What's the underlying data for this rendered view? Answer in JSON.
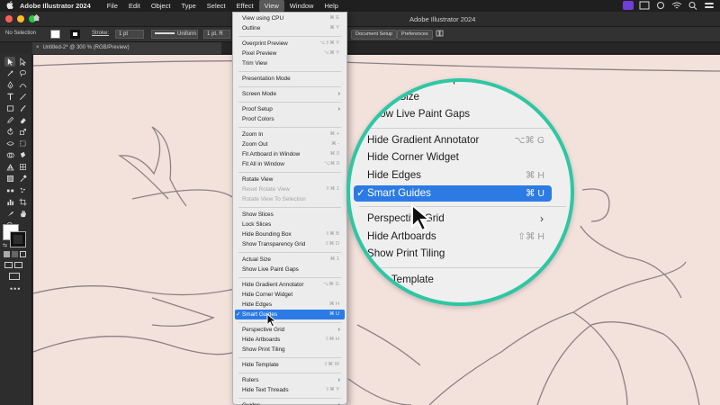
{
  "menubar": {
    "app_name": "Adobe Illustrator 2024",
    "menus": [
      "File",
      "Edit",
      "Object",
      "Type",
      "Select",
      "Effect",
      "View",
      "Window",
      "Help"
    ],
    "active_menu": "View"
  },
  "titlebar": {
    "title": "Adobe Illustrator 2024"
  },
  "controlbar": {
    "selection": "No Selection",
    "stroke_label": "Stroke:",
    "stroke_weight": "1 pt",
    "profile": "Uniform",
    "brush": "1 pt. R",
    "document_setup": "Document Setup",
    "preferences": "Preferences"
  },
  "document_tab": {
    "title": "Untitled-2* @ 300 % (RGB/Preview)"
  },
  "view_menu": {
    "items": [
      {
        "label": "View using CPU",
        "shortcut": "⌘ E"
      },
      {
        "label": "Outline",
        "shortcut": "⌘ Y"
      },
      {
        "sep": true
      },
      {
        "label": "Overprint Preview",
        "shortcut": "⌥⇧⌘ Y"
      },
      {
        "label": "Pixel Preview",
        "shortcut": "⌥⌘ Y"
      },
      {
        "label": "Trim View"
      },
      {
        "sep": true
      },
      {
        "label": "Presentation Mode"
      },
      {
        "sep": true
      },
      {
        "label": "Screen Mode",
        "submenu": true
      },
      {
        "sep": true
      },
      {
        "label": "Proof Setup",
        "submenu": true
      },
      {
        "label": "Proof Colors"
      },
      {
        "sep": true
      },
      {
        "label": "Zoom In",
        "shortcut": "⌘ +"
      },
      {
        "label": "Zoom Out",
        "shortcut": "⌘ -"
      },
      {
        "label": "Fit Artboard in Window",
        "shortcut": "⌘ 0"
      },
      {
        "label": "Fit All in Window",
        "shortcut": "⌥⌘ 0"
      },
      {
        "sep": true
      },
      {
        "label": "Rotate View"
      },
      {
        "label": "Reset Rotate View",
        "shortcut": "⇧⌘ 1",
        "disabled": true
      },
      {
        "label": "Rotate View To Selection",
        "disabled": true
      },
      {
        "sep": true
      },
      {
        "label": "Show Slices"
      },
      {
        "label": "Lock Slices"
      },
      {
        "label": "Hide Bounding Box",
        "shortcut": "⇧⌘ B"
      },
      {
        "label": "Show Transparency Grid",
        "shortcut": "⇧⌘ D"
      },
      {
        "sep": true
      },
      {
        "label": "Actual Size",
        "shortcut": "⌘ 1"
      },
      {
        "label": "Show Live Paint Gaps"
      },
      {
        "sep": true
      },
      {
        "label": "Hide Gradient Annotator",
        "shortcut": "⌥⌘ G"
      },
      {
        "label": "Hide Corner Widget"
      },
      {
        "label": "Hide Edges",
        "shortcut": "⌘ H"
      },
      {
        "label": "Smart Guides",
        "shortcut": "⌘ U",
        "checked": true,
        "highlighted": true
      },
      {
        "sep": true
      },
      {
        "label": "Perspective Grid",
        "submenu": true
      },
      {
        "label": "Hide Artboards",
        "shortcut": "⇧⌘ H"
      },
      {
        "label": "Show Print Tiling"
      },
      {
        "sep": true
      },
      {
        "label": "Hide Template",
        "shortcut": "⇧⌘ W"
      },
      {
        "sep": true
      },
      {
        "label": "Rulers",
        "submenu": true
      },
      {
        "label": "Hide Text Threads",
        "shortcut": "⇧⌘ Y"
      },
      {
        "sep": true
      },
      {
        "label": "Guides",
        "submenu": true
      }
    ]
  },
  "magnifier": {
    "items": [
      {
        "label": "Transparency Grid",
        "partial": true
      },
      {
        "label": "Actual Size"
      },
      {
        "label": "Show Live Paint Gaps"
      },
      {
        "sep": true
      },
      {
        "label": "Hide Gradient Annotator",
        "shortcut": "⌥⌘ G"
      },
      {
        "label": "Hide Corner Widget"
      },
      {
        "label": "Hide Edges",
        "shortcut": "⌘ H"
      },
      {
        "label": "Smart Guides",
        "shortcut": "⌘ U",
        "checked": true,
        "highlighted": true
      },
      {
        "sep": true
      },
      {
        "label": "Perspective Grid",
        "submenu": true
      },
      {
        "label": "Hide Artboards",
        "shortcut": "⇧⌘ H"
      },
      {
        "label": "Show Print Tiling"
      },
      {
        "sep": true
      },
      {
        "label": "Hide Template"
      }
    ],
    "check_mark": "✓",
    "border_color": "#2ec7a3"
  },
  "icons": {
    "apple": "apple-icon",
    "home": "home-icon",
    "submenu": "chevron-right-icon",
    "check": "checkmark-icon",
    "cursor": "mouse-pointer-icon"
  },
  "colors": {
    "highlight": "#2c7be5",
    "canvas": "#f3e1dc",
    "accent": "#2ec7a3"
  }
}
